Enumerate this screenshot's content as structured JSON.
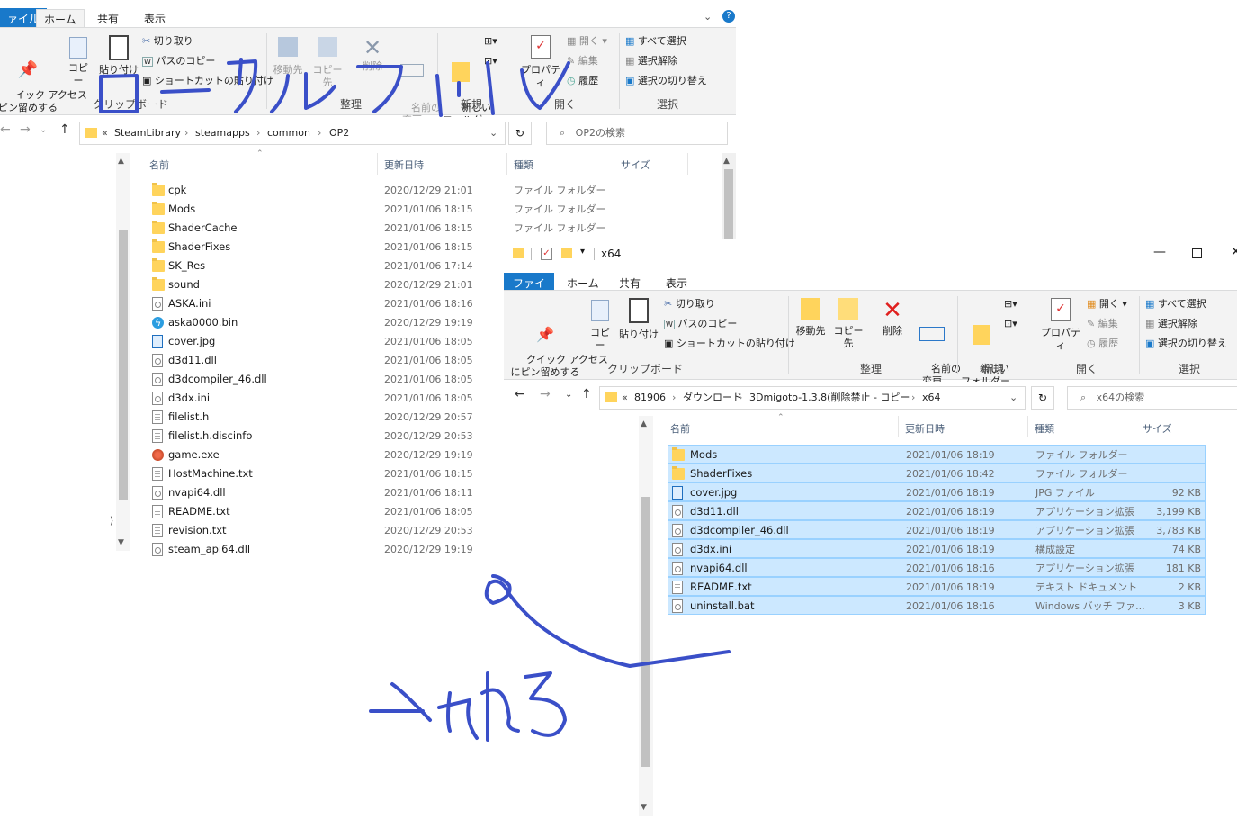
{
  "win1": {
    "tabs": [
      "ァイル",
      "ホーム",
      "共有",
      "表示"
    ],
    "ribbon": {
      "pin": "イック アクセス\nピン留めする",
      "copy": "コピー",
      "paste": "貼り付け",
      "cut": "切り取り",
      "copy_path": "パスのコピー",
      "paste_shortcut": "ショートカットの貼り付け",
      "clipboard_group": "クリップボード",
      "move_to": "移動先",
      "copy_to": "コピー先",
      "delete": "削除",
      "rename": "名前の\n変更",
      "organize_group": "整理",
      "new_folder": "新しい\nフォルダー",
      "new_group": "新規",
      "properties": "プロパティ",
      "open": "開く",
      "edit": "編集",
      "history": "履歴",
      "open_group": "開く",
      "select_all": "すべて選択",
      "select_none": "選択解除",
      "invert": "選択の切り替え",
      "select_group": "選択"
    },
    "breadcrumb": [
      "«",
      "SteamLibrary",
      "›",
      "steamapps",
      "›",
      "common",
      "›",
      "OP2"
    ],
    "search_placeholder": "OP2の検索",
    "columns": {
      "name": "名前",
      "date": "更新日時",
      "type": "種類",
      "size": "サイズ"
    },
    "files": [
      {
        "name": "cpk",
        "date": "2020/12/29 21:01",
        "type": "ファイル フォルダー",
        "icon": "folder"
      },
      {
        "name": "Mods",
        "date": "2021/01/06 18:15",
        "type": "ファイル フォルダー",
        "icon": "folder"
      },
      {
        "name": "ShaderCache",
        "date": "2021/01/06 18:15",
        "type": "ファイル フォルダー",
        "icon": "folder"
      },
      {
        "name": "ShaderFixes",
        "date": "2021/01/06 18:15",
        "type": "",
        "icon": "folder"
      },
      {
        "name": "SK_Res",
        "date": "2021/01/06 17:14",
        "type": "",
        "icon": "folder"
      },
      {
        "name": "sound",
        "date": "2020/12/29 21:01",
        "type": "",
        "icon": "folder"
      },
      {
        "name": "ASKA.ini",
        "date": "2021/01/06 18:16",
        "type": "",
        "icon": "gear"
      },
      {
        "name": "aska0000.bin",
        "date": "2020/12/29 19:19",
        "type": "",
        "icon": "bin"
      },
      {
        "name": "cover.jpg",
        "date": "2021/01/06 18:05",
        "type": "",
        "icon": "image"
      },
      {
        "name": "d3d11.dll",
        "date": "2021/01/06 18:05",
        "type": "",
        "icon": "gear"
      },
      {
        "name": "d3dcompiler_46.dll",
        "date": "2021/01/06 18:05",
        "type": "",
        "icon": "gear"
      },
      {
        "name": "d3dx.ini",
        "date": "2021/01/06 18:05",
        "type": "",
        "icon": "gear"
      },
      {
        "name": "filelist.h",
        "date": "2020/12/29 20:57",
        "type": "",
        "icon": "doc"
      },
      {
        "name": "filelist.h.discinfo",
        "date": "2020/12/29 20:53",
        "type": "",
        "icon": "doc"
      },
      {
        "name": "game.exe",
        "date": "2020/12/29 19:19",
        "type": "",
        "icon": "exe"
      },
      {
        "name": "HostMachine.txt",
        "date": "2021/01/06 18:15",
        "type": "",
        "icon": "doc"
      },
      {
        "name": "nvapi64.dll",
        "date": "2021/01/06 18:11",
        "type": "",
        "icon": "gear"
      },
      {
        "name": "README.txt",
        "date": "2021/01/06 18:05",
        "type": "",
        "icon": "doc"
      },
      {
        "name": "revision.txt",
        "date": "2020/12/29 20:53",
        "type": "",
        "icon": "doc"
      },
      {
        "name": "steam_api64.dll",
        "date": "2020/12/29 19:19",
        "type": "",
        "icon": "gear"
      }
    ]
  },
  "win2": {
    "title": "x64",
    "tabs": [
      "ファイル",
      "ホーム",
      "共有",
      "表示"
    ],
    "ribbon": {
      "pin": "クイック アクセス\nにピン留めする",
      "copy": "コピー",
      "paste": "貼り付け",
      "cut": "切り取り",
      "copy_path": "パスのコピー",
      "paste_shortcut": "ショートカットの貼り付け",
      "clipboard_group": "クリップボード",
      "move_to": "移動先",
      "copy_to": "コピー先",
      "delete": "削除",
      "rename": "名前の\n変更",
      "organize_group": "整理",
      "new_folder": "新しい\nフォルダー",
      "new_group": "新規",
      "properties": "プロパティ",
      "open": "開く",
      "edit": "編集",
      "history": "履歴",
      "open_group": "開く",
      "select_all": "すべて選択",
      "select_none": "選択解除",
      "invert": "選択の切り替え",
      "select_group": "選択"
    },
    "breadcrumb": [
      "«",
      "81906",
      "›",
      "ダウンロード",
      "›",
      "3Dmigoto-1.3.8(削除禁止 - コピー",
      "›",
      "x64"
    ],
    "search_placeholder": "x64の検索",
    "columns": {
      "name": "名前",
      "date": "更新日時",
      "type": "種類",
      "size": "サイズ"
    },
    "files": [
      {
        "name": "Mods",
        "date": "2021/01/06 18:19",
        "type": "ファイル フォルダー",
        "size": "",
        "icon": "folder"
      },
      {
        "name": "ShaderFixes",
        "date": "2021/01/06 18:42",
        "type": "ファイル フォルダー",
        "size": "",
        "icon": "folder"
      },
      {
        "name": "cover.jpg",
        "date": "2021/01/06 18:19",
        "type": "JPG ファイル",
        "size": "92 KB",
        "icon": "image"
      },
      {
        "name": "d3d11.dll",
        "date": "2021/01/06 18:19",
        "type": "アプリケーション拡張",
        "size": "3,199 KB",
        "icon": "gear"
      },
      {
        "name": "d3dcompiler_46.dll",
        "date": "2021/01/06 18:19",
        "type": "アプリケーション拡張",
        "size": "3,783 KB",
        "icon": "gear"
      },
      {
        "name": "d3dx.ini",
        "date": "2021/01/06 18:19",
        "type": "構成設定",
        "size": "74 KB",
        "icon": "gear"
      },
      {
        "name": "nvapi64.dll",
        "date": "2021/01/06 18:16",
        "type": "アプリケーション拡張",
        "size": "181 KB",
        "icon": "gear"
      },
      {
        "name": "README.txt",
        "date": "2021/01/06 18:19",
        "type": "テキスト ドキュメント",
        "size": "2 KB",
        "icon": "doc"
      },
      {
        "name": "uninstall.bat",
        "date": "2021/01/06 18:16",
        "type": "Windows バッチ ファ...",
        "size": "3 KB",
        "icon": "gear"
      }
    ]
  },
  "colors": {
    "accent": "#1979ca",
    "selection": "#cce8ff",
    "selection_border": "#99d1ff",
    "ink": "#3a4fc8"
  }
}
